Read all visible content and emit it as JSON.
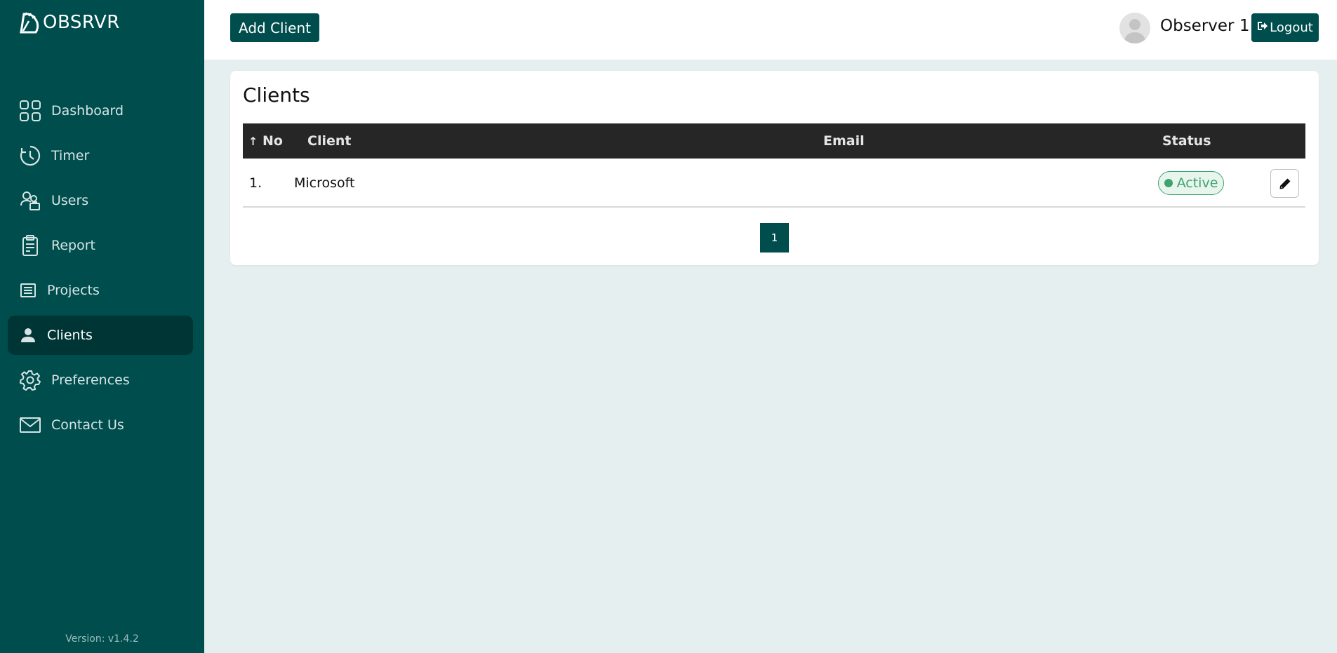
{
  "brand": {
    "name": "OBSRVR"
  },
  "sidebar": {
    "items": [
      {
        "label": "Dashboard",
        "icon": "grid-icon"
      },
      {
        "label": "Timer",
        "icon": "clock-icon"
      },
      {
        "label": "Users",
        "icon": "users-icon"
      },
      {
        "label": "Report",
        "icon": "clipboard-icon"
      },
      {
        "label": "Projects",
        "icon": "list-icon"
      },
      {
        "label": "Clients",
        "icon": "person-icon",
        "active": true
      },
      {
        "label": "Preferences",
        "icon": "gear-icon"
      },
      {
        "label": "Contact Us",
        "icon": "mail-icon"
      }
    ],
    "version": "Version: v1.4.2"
  },
  "header": {
    "add_button": "Add Client",
    "user_name": "Observer 1",
    "logout": "Logout"
  },
  "main": {
    "title": "Clients",
    "table": {
      "columns": [
        "No",
        "Client",
        "Email",
        "Status"
      ],
      "sort_indicator": "↑",
      "rows": [
        {
          "no": "1.",
          "client": "Microsoft",
          "email": "",
          "status": "Active"
        }
      ]
    },
    "pagination": {
      "current": "1"
    }
  },
  "colors": {
    "sidebar": "#004d4d",
    "active_nav": "#003535",
    "table_header": "#262626",
    "status_active": "#3ea36f",
    "page_bg": "#e6eff0"
  }
}
